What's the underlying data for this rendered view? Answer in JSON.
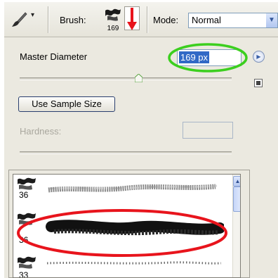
{
  "options_bar": {
    "tool_icon": "brush-tool-icon",
    "tool_menu_caret": "▾",
    "brush_label": "Brush:",
    "brush_size": "169",
    "mode_label": "Mode:",
    "mode_value": "Normal"
  },
  "panel": {
    "master_diameter_label": "Master Diameter",
    "master_diameter_value": "169 px",
    "diameter_slider_level": 0.56,
    "use_sample_size_label": "Use Sample Size",
    "hardness_label": "Hardness:",
    "hardness_value": "",
    "hardness_slider_level": 0.0
  },
  "presets": [
    {
      "size": "36",
      "selected": false
    },
    {
      "size": "36",
      "selected": true
    },
    {
      "size": "33",
      "selected": false
    }
  ],
  "annotations": {
    "green_highlight": "#3ccf1f",
    "red_highlight": "#e8141c"
  },
  "colors": {
    "panel_bg": "#ebe9e0",
    "selection_blue": "#3169c6",
    "field_border": "#7f9db9"
  }
}
